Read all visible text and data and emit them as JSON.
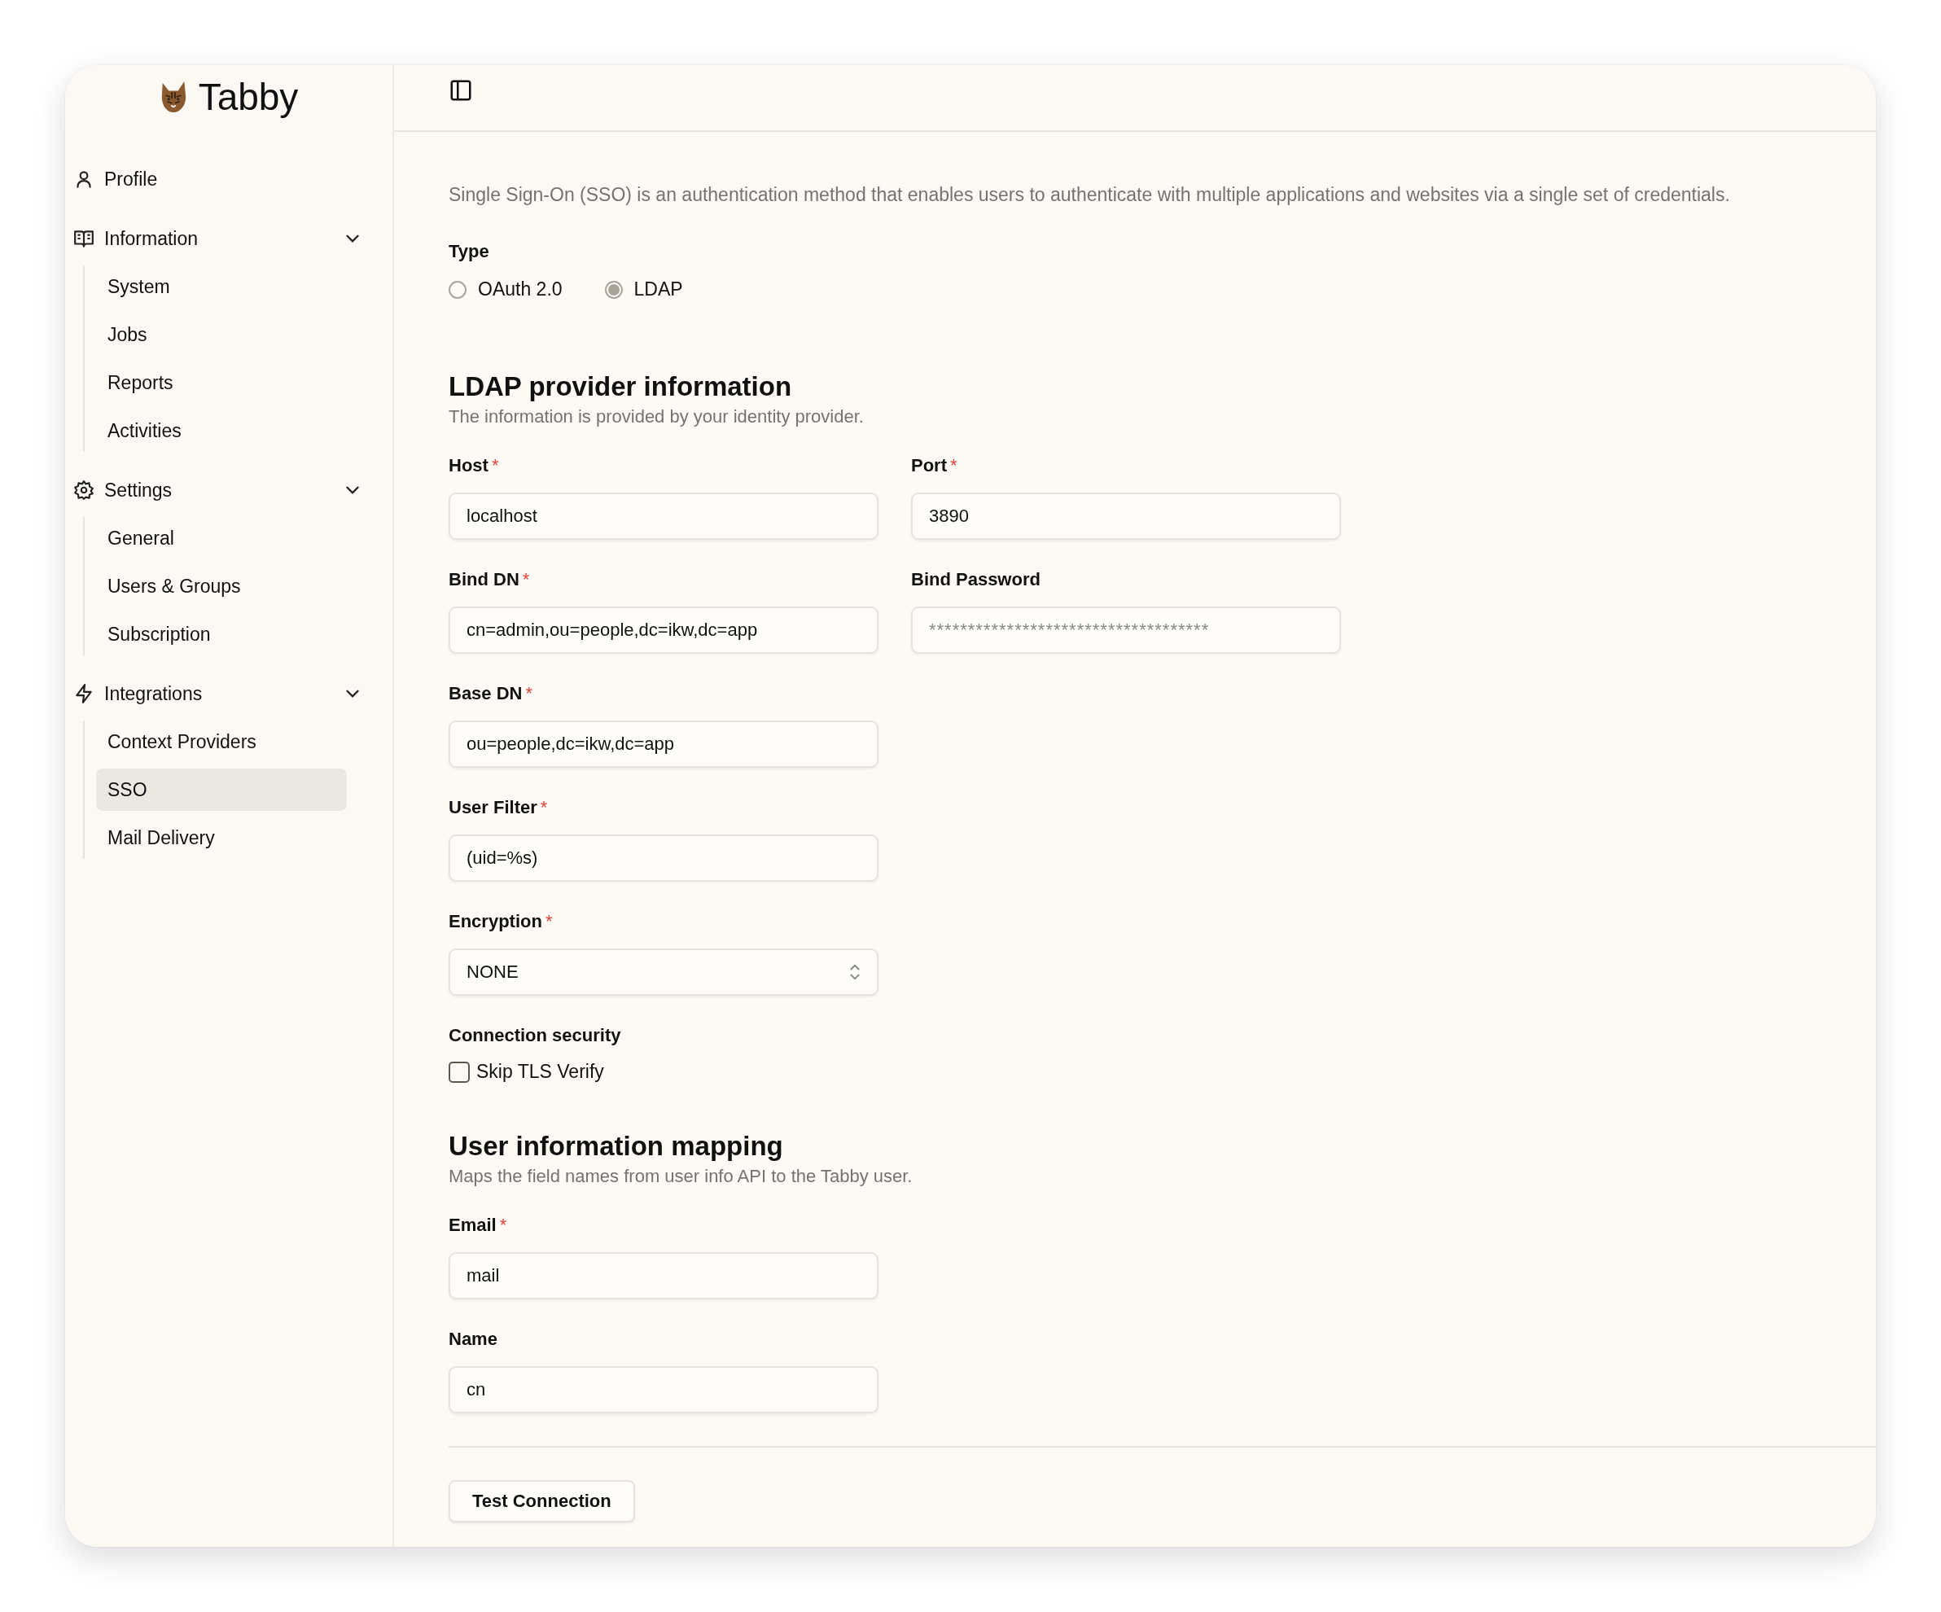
{
  "app": {
    "name": "Tabby"
  },
  "sidebar": {
    "items": [
      {
        "label": "Profile"
      },
      {
        "label": "Information",
        "expanded": true,
        "children": [
          {
            "label": "System",
            "selected": false
          },
          {
            "label": "Jobs",
            "selected": false
          },
          {
            "label": "Reports",
            "selected": false
          },
          {
            "label": "Activities",
            "selected": false
          }
        ]
      },
      {
        "label": "Settings",
        "expanded": true,
        "children": [
          {
            "label": "General",
            "selected": false
          },
          {
            "label": "Users & Groups",
            "selected": false
          },
          {
            "label": "Subscription",
            "selected": false
          }
        ]
      },
      {
        "label": "Integrations",
        "expanded": true,
        "children": [
          {
            "label": "Context Providers",
            "selected": false
          },
          {
            "label": "SSO",
            "selected": true
          },
          {
            "label": "Mail Delivery",
            "selected": false
          }
        ]
      }
    ]
  },
  "form": {
    "description": "Single Sign-On (SSO) is an authentication method that enables users to authenticate with multiple applications and websites via a single set of credentials.",
    "required_mark": "*",
    "type": {
      "label": "Type",
      "options": [
        {
          "label": "OAuth 2.0",
          "selected": false
        },
        {
          "label": "LDAP",
          "selected": true
        }
      ]
    },
    "sections": [
      {
        "title": "LDAP provider information",
        "subtitle": "The information is provided by your identity provider.",
        "rows": [
          [
            {
              "kind": "text",
              "label": "Host",
              "required": true,
              "value": "localhost"
            },
            {
              "kind": "text",
              "label": "Port",
              "required": true,
              "value": "3890"
            }
          ],
          [
            {
              "kind": "text",
              "label": "Bind DN",
              "required": true,
              "value": "cn=admin,ou=people,dc=ikw,dc=app"
            },
            {
              "kind": "password",
              "label": "Bind Password",
              "required": false,
              "placeholder": "************************************"
            }
          ],
          [
            {
              "kind": "text",
              "label": "Base DN",
              "required": true,
              "value": "ou=people,dc=ikw,dc=app"
            }
          ],
          [
            {
              "kind": "text",
              "label": "User Filter",
              "required": true,
              "value": "(uid=%s)"
            }
          ],
          [
            {
              "kind": "select",
              "label": "Encryption",
              "required": true,
              "value": "NONE"
            }
          ],
          [
            {
              "kind": "checkbox",
              "label": "Connection security",
              "required": false,
              "option": "Skip TLS Verify",
              "checked": false
            }
          ]
        ]
      },
      {
        "title": "User information mapping",
        "subtitle": "Maps the field names from user info API to the Tabby user.",
        "rows": [
          [
            {
              "kind": "text",
              "label": "Email",
              "required": true,
              "value": "mail"
            }
          ],
          [
            {
              "kind": "text",
              "label": "Name",
              "required": false,
              "value": "cn"
            }
          ]
        ]
      }
    ],
    "button": "Test Connection"
  }
}
